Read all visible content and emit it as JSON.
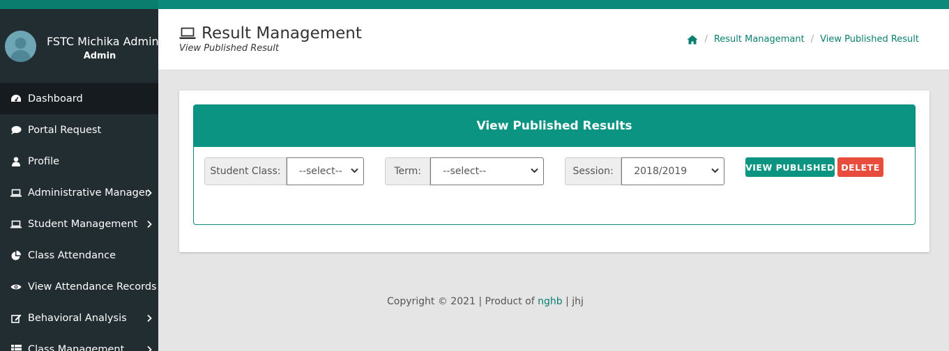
{
  "sidebar": {
    "user_name": "FSTC Michika Admin",
    "user_role": "Admin",
    "items": [
      {
        "label": "Dashboard",
        "icon": "dashboard-icon",
        "active": true,
        "has_caret": false
      },
      {
        "label": "Portal Request",
        "icon": "comment-icon",
        "active": false,
        "has_caret": false
      },
      {
        "label": "Profile",
        "icon": "user-icon",
        "active": false,
        "has_caret": false
      },
      {
        "label": "Administrative Manager",
        "icon": "laptop-icon",
        "active": false,
        "has_caret": true
      },
      {
        "label": "Student Management",
        "icon": "laptop-icon",
        "active": false,
        "has_caret": true
      },
      {
        "label": "Class Attendance",
        "icon": "pie-chart-icon",
        "active": false,
        "has_caret": false
      },
      {
        "label": "View Attendance Records",
        "icon": "eye-icon",
        "active": false,
        "has_caret": false
      },
      {
        "label": "Behavioral Analysis",
        "icon": "edit-icon",
        "active": false,
        "has_caret": true
      },
      {
        "label": "Class Management",
        "icon": "list-icon",
        "active": false,
        "has_caret": true
      }
    ]
  },
  "header": {
    "title": "Result Management",
    "subtitle": "View Published Result",
    "breadcrumb": [
      "Result Managemant",
      "View Published Result"
    ]
  },
  "panel": {
    "heading": "View Published Results",
    "student_class": {
      "label": "Student Class:",
      "value": "--select--"
    },
    "term": {
      "label": "Term:",
      "value": "--select--"
    },
    "session": {
      "label": "Session:",
      "value": "2018/2019"
    },
    "view_button": "VIEW PUBLISHED",
    "delete_button": "DELETE"
  },
  "footer": {
    "prefix": "Copyright © 2021 | Product of ",
    "link": "nghb",
    "suffix": " | jhj"
  },
  "colors": {
    "brand": "#0b9482",
    "sidebar": "#222d32",
    "danger": "#e74c3c"
  }
}
